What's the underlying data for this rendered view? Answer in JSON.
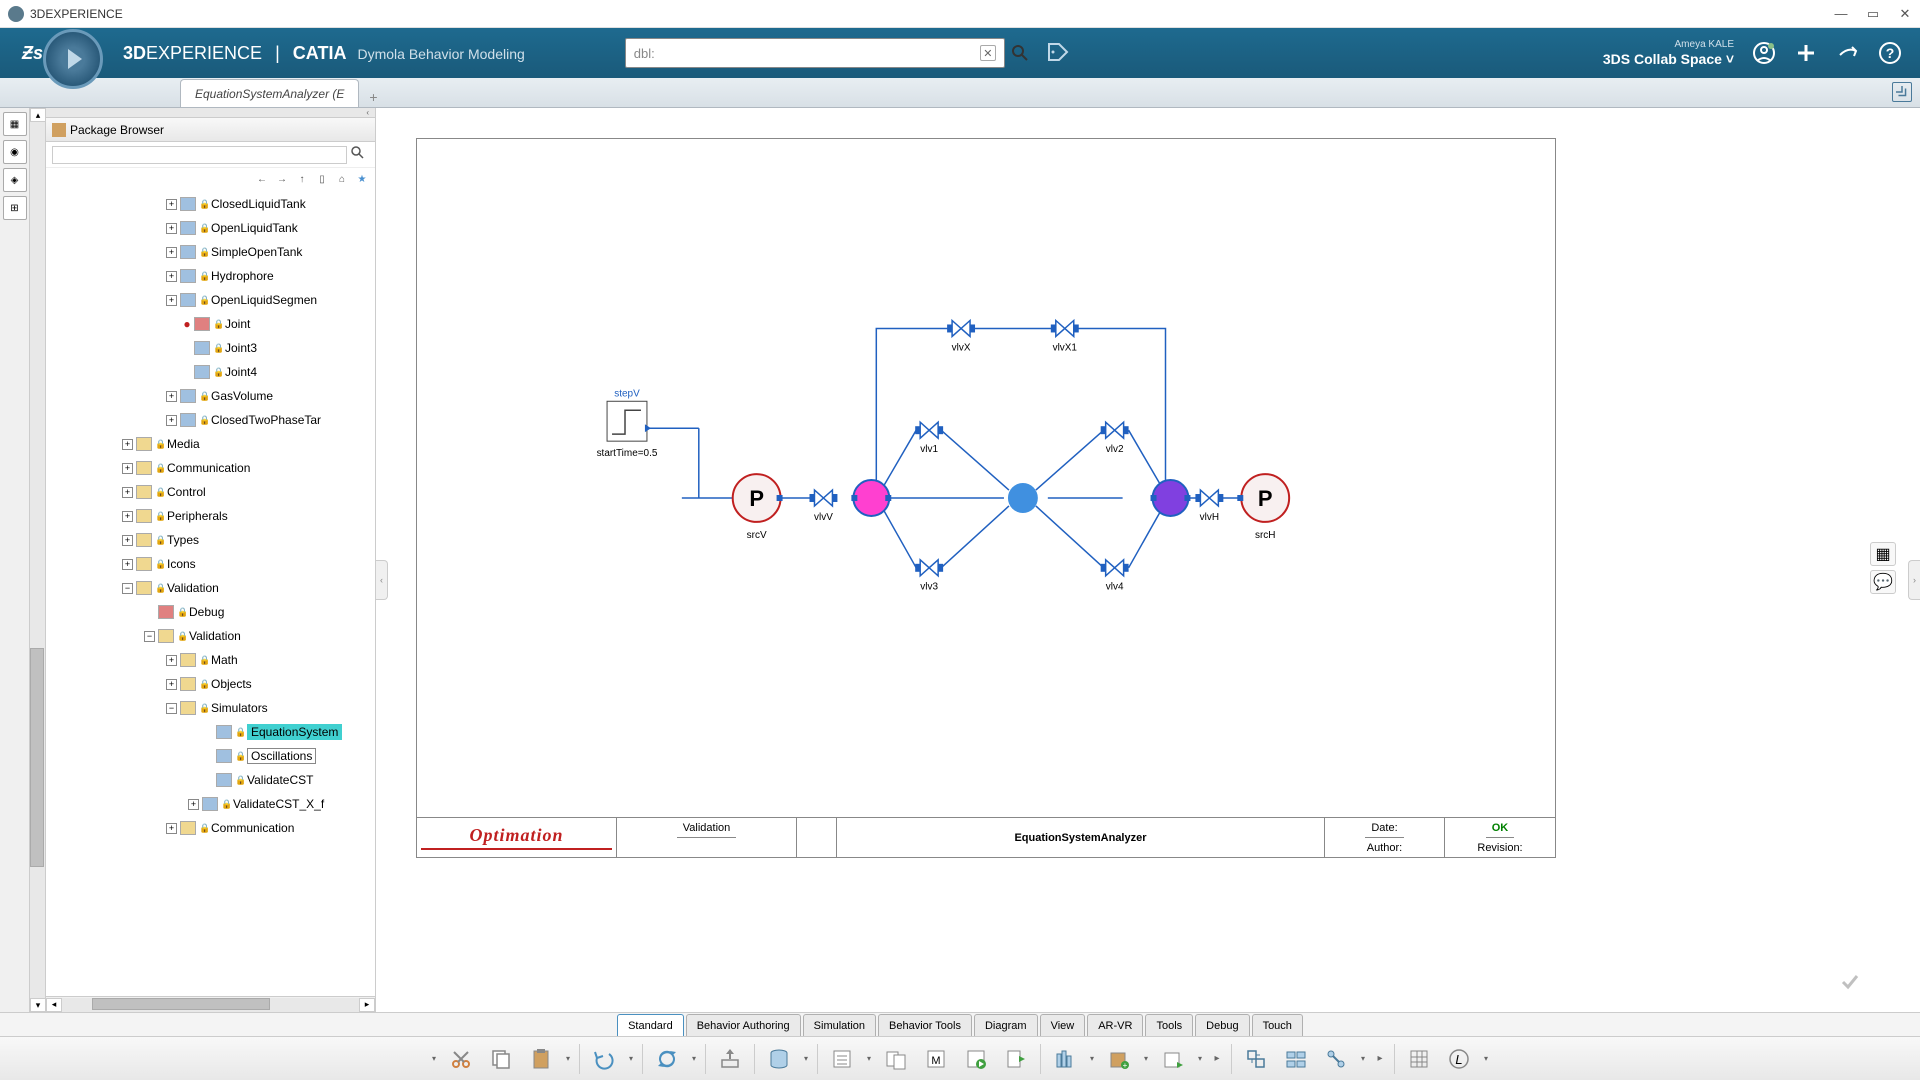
{
  "titlebar": {
    "title": "3DEXPERIENCE"
  },
  "topbar": {
    "brand_prefix": "3D",
    "brand_main": "EXPERIENCE",
    "brand_sep": "|",
    "brand_app": "CATIA",
    "brand_sub": "Dymola Behavior Modeling",
    "search_value": "dbl:",
    "user": "Ameya KALE",
    "collab_space": "3DS Collab Space",
    "collab_chevron": "˅"
  },
  "tabs": {
    "active": "EquationSystemAnalyzer (E"
  },
  "package_browser": {
    "title": "Package Browser",
    "tree": [
      {
        "pad": 120,
        "exp": "+",
        "icon": "blue",
        "label": "ClosedLiquidTank",
        "lock": true
      },
      {
        "pad": 120,
        "exp": "+",
        "icon": "blue",
        "label": "OpenLiquidTank",
        "lock": true
      },
      {
        "pad": 120,
        "exp": "+",
        "icon": "blue",
        "label": "SimpleOpenTank",
        "lock": true
      },
      {
        "pad": 120,
        "exp": "+",
        "icon": "blue",
        "label": "Hydrophore",
        "lock": true
      },
      {
        "pad": 120,
        "exp": "+",
        "icon": "blue",
        "label": "OpenLiquidSegmen",
        "lock": true
      },
      {
        "pad": 134,
        "icon": "red",
        "label": "Joint",
        "lock": true,
        "noexp": true,
        "dot": true
      },
      {
        "pad": 134,
        "icon": "blue",
        "label": "Joint3",
        "lock": true,
        "noexp": true
      },
      {
        "pad": 134,
        "icon": "blue",
        "label": "Joint4",
        "lock": true,
        "noexp": true
      },
      {
        "pad": 120,
        "exp": "+",
        "icon": "blue",
        "label": "GasVolume",
        "lock": true
      },
      {
        "pad": 120,
        "exp": "+",
        "icon": "blue",
        "label": "ClosedTwoPhaseTar",
        "lock": true
      },
      {
        "pad": 76,
        "exp": "+",
        "icon": "pkg",
        "label": "Media",
        "lock": true
      },
      {
        "pad": 76,
        "exp": "+",
        "icon": "pkg",
        "label": "Communication",
        "lock": true
      },
      {
        "pad": 76,
        "exp": "+",
        "icon": "pkg",
        "label": "Control",
        "lock": true
      },
      {
        "pad": 76,
        "exp": "+",
        "icon": "pkg",
        "label": "Peripherals",
        "lock": true
      },
      {
        "pad": 76,
        "exp": "+",
        "icon": "pkg",
        "label": "Types",
        "lock": true
      },
      {
        "pad": 76,
        "exp": "+",
        "icon": "pkg",
        "label": "Icons",
        "lock": true
      },
      {
        "pad": 76,
        "exp": "−",
        "icon": "pkg",
        "label": "Validation",
        "lock": true
      },
      {
        "pad": 98,
        "icon": "red",
        "label": "Debug",
        "lock": true,
        "noexp": true
      },
      {
        "pad": 98,
        "exp": "−",
        "icon": "pkg",
        "label": "Validation",
        "lock": true
      },
      {
        "pad": 120,
        "exp": "+",
        "icon": "pkg",
        "label": "Math",
        "lock": true
      },
      {
        "pad": 120,
        "exp": "+",
        "icon": "pkg",
        "label": "Objects",
        "lock": true
      },
      {
        "pad": 120,
        "exp": "−",
        "icon": "pkg",
        "label": "Simulators",
        "lock": true
      },
      {
        "pad": 156,
        "icon": "blue",
        "label": "EquationSystem",
        "lock": true,
        "noexp": true,
        "selected": true
      },
      {
        "pad": 156,
        "icon": "blue",
        "label": "Oscillations",
        "lock": true,
        "noexp": true,
        "box": true
      },
      {
        "pad": 156,
        "icon": "blue",
        "label": "ValidateCST",
        "lock": true,
        "noexp": true
      },
      {
        "pad": 142,
        "exp": "+",
        "icon": "blue",
        "label": "ValidateCST_X_f",
        "lock": true
      },
      {
        "pad": 120,
        "exp": "+",
        "icon": "pkg",
        "label": "Communication",
        "lock": true
      }
    ]
  },
  "diagram": {
    "step_label": "stepV",
    "step_time": "startTime=0.5",
    "srcV": "srcV",
    "srcH": "srcH",
    "p_label": "P",
    "vlvV": "vlvV",
    "vlvH": "vlvH",
    "vlv1": "vlv1",
    "vlv2": "vlv2",
    "vlv3": "vlv3",
    "vlv4": "vlv4",
    "vlvX": "vlvX",
    "vlvX1": "vlvX1"
  },
  "titleblock": {
    "validation": "Validation",
    "name": "EquationSystemAnalyzer",
    "date": "Date:",
    "ok": "OK",
    "author": "Author:",
    "revision": "Revision:"
  },
  "bottom_tabs": [
    "Standard",
    "Behavior Authoring",
    "Simulation",
    "Behavior Tools",
    "Diagram",
    "View",
    "AR-VR",
    "Tools",
    "Debug",
    "Touch"
  ],
  "bottom_tabs_active": 0
}
